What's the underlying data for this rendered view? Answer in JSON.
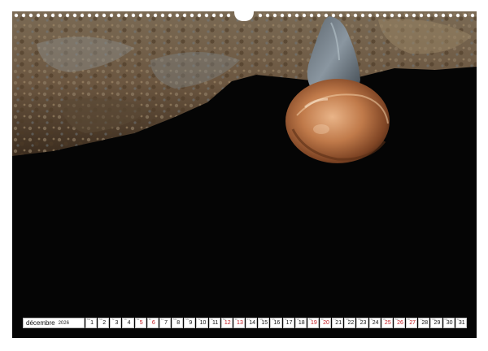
{
  "calendar": {
    "month": "décembre",
    "year": "2026",
    "days": [
      {
        "n": "1",
        "wd": "Ma",
        "red": false
      },
      {
        "n": "2",
        "wd": "Me",
        "red": false
      },
      {
        "n": "3",
        "wd": "Je",
        "red": false
      },
      {
        "n": "4",
        "wd": "Ve",
        "red": false
      },
      {
        "n": "5",
        "wd": "Sa",
        "red": true
      },
      {
        "n": "6",
        "wd": "Di",
        "red": true
      },
      {
        "n": "7",
        "wd": "Lu",
        "red": false
      },
      {
        "n": "8",
        "wd": "Ma",
        "red": false
      },
      {
        "n": "9",
        "wd": "Me",
        "red": false
      },
      {
        "n": "10",
        "wd": "Je",
        "red": false
      },
      {
        "n": "11",
        "wd": "Ve",
        "red": false
      },
      {
        "n": "12",
        "wd": "Sa",
        "red": true
      },
      {
        "n": "13",
        "wd": "Di",
        "red": true
      },
      {
        "n": "14",
        "wd": "Lu",
        "red": false
      },
      {
        "n": "15",
        "wd": "Ma",
        "red": false
      },
      {
        "n": "16",
        "wd": "Me",
        "red": false
      },
      {
        "n": "17",
        "wd": "Je",
        "red": false
      },
      {
        "n": "18",
        "wd": "Ve",
        "red": false
      },
      {
        "n": "19",
        "wd": "Sa",
        "red": true
      },
      {
        "n": "20",
        "wd": "Di",
        "red": true
      },
      {
        "n": "21",
        "wd": "Lu",
        "red": false
      },
      {
        "n": "22",
        "wd": "Ma",
        "red": false
      },
      {
        "n": "23",
        "wd": "Me",
        "red": false
      },
      {
        "n": "24",
        "wd": "Je",
        "red": false
      },
      {
        "n": "25",
        "wd": "Ve",
        "red": true
      },
      {
        "n": "26",
        "wd": "Sa",
        "red": true
      },
      {
        "n": "27",
        "wd": "Di",
        "red": true
      },
      {
        "n": "28",
        "wd": "Lu",
        "red": false
      },
      {
        "n": "29",
        "wd": "Ma",
        "red": false
      },
      {
        "n": "30",
        "wd": "Me",
        "red": false
      },
      {
        "n": "31",
        "wd": "Je",
        "red": false
      }
    ]
  },
  "colors": {
    "weekend_red": "#c0171d",
    "photo_background": "#050505"
  }
}
